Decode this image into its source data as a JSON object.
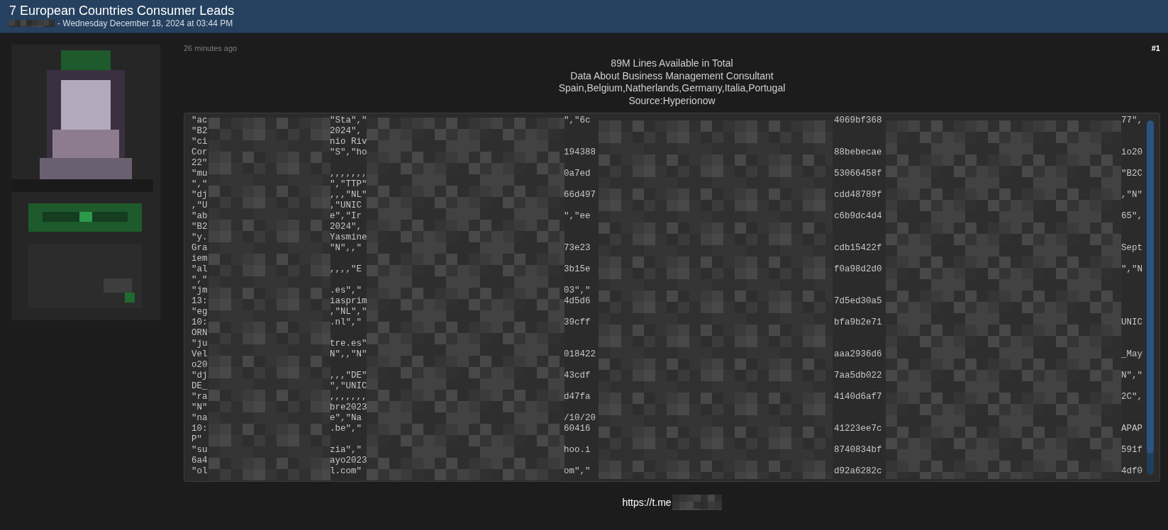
{
  "thread": {
    "title": "7 European Countries Consumer Leads",
    "byline": "- Wednesday December 18, 2024 at 03:44 PM"
  },
  "post": {
    "time": "26 minutes ago",
    "number": "#1",
    "intro_lines": [
      "89M Lines Available in Total",
      "Data About Business Management Consultant",
      "Spain,Belgium,Natherlands,Germany,Italia,Portugal",
      "Source:Hyperionow"
    ],
    "code_lines": [
      {
        "col_1": "\"ac",
        "col_2": "\"Sta\",\"",
        "col_3": "\",\"6c",
        "col_4": "4069bf368",
        "col_5": "77\","
      },
      {
        "col_1": "\"B2",
        "col_2": "2024\","
      },
      {
        "col_1": "\"ci",
        "col_2": "nio Riv"
      },
      {
        "col_1": "Cor",
        "col_2": "\"S\",\"ho",
        "col_3": "194388",
        "col_4": "88bebecae",
        "col_5": "io20"
      },
      {
        "col_1": "22\""
      },
      {
        "col_1": "\"mu",
        "col_2": ",,,,,,,",
        "col_3": "0a7ed",
        "col_4": "53066458f",
        "col_5": "\"B2C"
      },
      {
        "col_1": "\",\"",
        "col_2": "\",\"TTP\""
      },
      {
        "col_1": "\"dj",
        "col_2": ",,,\"NL\"",
        "col_3": "66d497",
        "col_4": "cdd48789f",
        "col_5": ",\"N\""
      },
      {
        "col_1": ",\"U",
        "col_2": ",\"UNIC"
      },
      {
        "col_1": "\"ab",
        "col_2": "e\",\"Ir",
        "col_3": "\",\"ee",
        "col_4": "c6b9dc4d4",
        "col_5": "65\","
      },
      {
        "col_1": "\"B2",
        "col_2": "2024\","
      },
      {
        "col_1": "\"y.",
        "col_2": "Yasmine"
      },
      {
        "col_1": "Gra",
        "col_2": "\"N\",,\"",
        "col_3": "73e23",
        "col_4": "cdb15422f",
        "col_5": "Sept"
      },
      {
        "col_1": "iem"
      },
      {
        "col_1": "\"al",
        "col_2": ",,,,\"E",
        "col_3": "3b15e",
        "col_4": "f0a98d2d0",
        "col_5": "\",\"N"
      },
      {
        "col_1": "\",\""
      },
      {
        "col_1": "\"jm",
        "col_2": ".es\",\"",
        "col_3": "03\",\""
      },
      {
        "col_1": "13:",
        "col_2": "iasprim",
        "col_3": "4d5d6",
        "col_4": "7d5ed30a5"
      },
      {
        "col_1": "\"eg",
        "col_2": ",\"NL\",\""
      },
      {
        "col_1": "10:",
        "col_2": ".nl\",\"",
        "col_3": "39cff",
        "col_4": "bfa9b2e71",
        "col_5": "UNIC"
      },
      {
        "col_1": "ORN"
      },
      {
        "col_1": "\"ju",
        "col_2": "tre.es\""
      },
      {
        "col_1": "Vel",
        "col_2": "N\",,\"N\"",
        "col_3": "018422",
        "col_4": "aaa2936d6",
        "col_5": "_May"
      },
      {
        "col_1": "o20"
      },
      {
        "col_1": "\"dj",
        "col_2": ",,,\"DE\"",
        "col_3": "43cdf",
        "col_4": "7aa5db022",
        "col_5": "N\",\""
      },
      {
        "col_1": "DE_",
        "col_2": "\",\"UNIC"
      },
      {
        "col_1": "\"ra",
        "col_2": ",,,,,,,",
        "col_3": "d47fa",
        "col_4": "4140d6af7",
        "col_5": "2C\","
      },
      {
        "col_1": "\"N\"",
        "col_2": "bre2023"
      },
      {
        "col_1": "\"na",
        "col_2": "e\",\"Na",
        "col_3": "/10/20"
      },
      {
        "col_1": "10:",
        "col_2": ".be\",\"",
        "col_3": "60416",
        "col_4": "41223ee7c",
        "col_5": "APAP"
      },
      {
        "col_1": "P\""
      },
      {
        "col_1": "\"su",
        "col_2": "zia\",\"",
        "col_3": "hoo.i",
        "col_4": "8740834bf",
        "col_5": "591f"
      },
      {
        "col_1": "6a4",
        "col_2": "ayo2023"
      },
      {
        "col_1": "\"ol",
        "col_2": "l.com\"",
        "col_3": "om\",\"",
        "col_4": "d92a6282c",
        "col_5": "4df0"
      }
    ],
    "link": "https://t.me"
  }
}
